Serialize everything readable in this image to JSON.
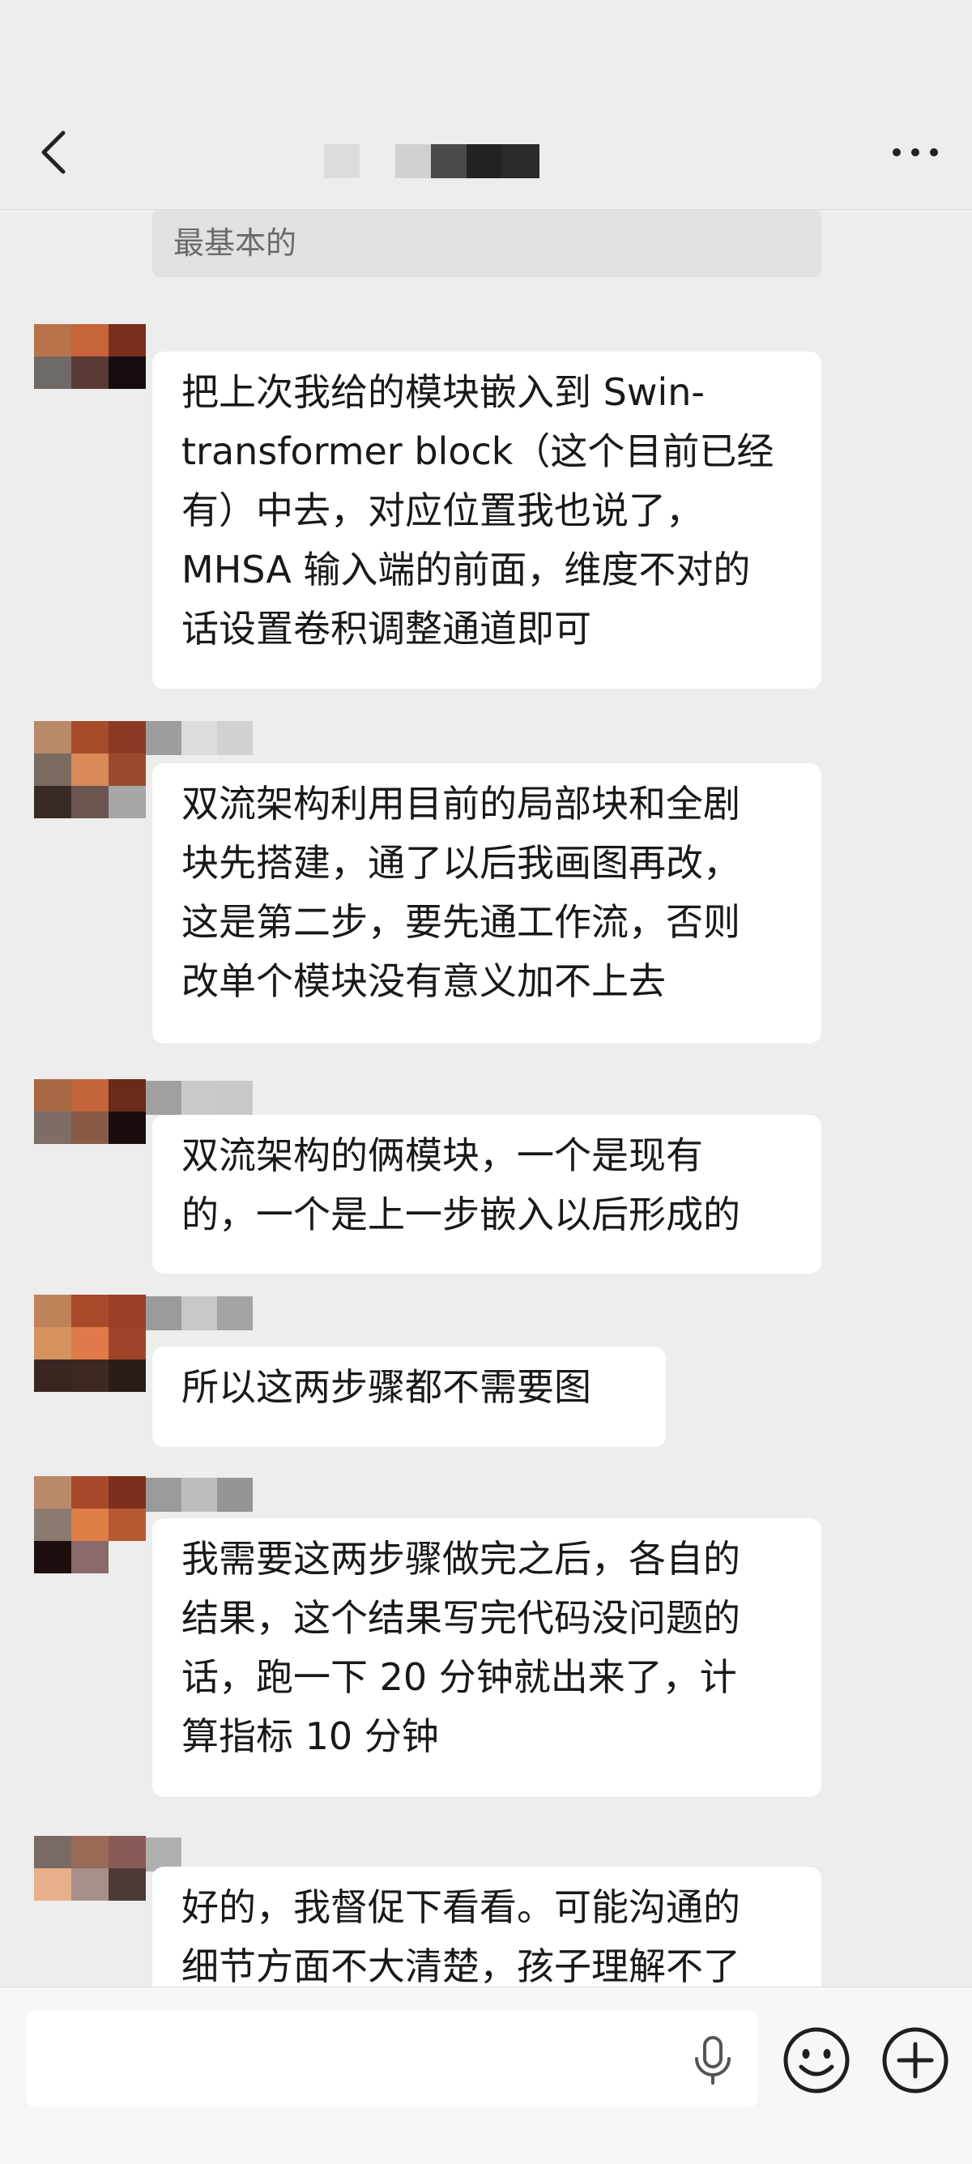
{
  "header": {
    "back_icon": "chevron-left-icon",
    "title": "■ ■■■■",
    "more_icon": "more-horizontal-icon"
  },
  "quoted_message": "最基本的",
  "messages": [
    {
      "text": "把上次我给的模块嵌入到 Swin-\ntransformer block（这个目前已经\n有）中去，对应位置我也说了，\nMHSA 输入端的前面，维度不对的\n话设置卷积调整通道即可"
    },
    {
      "text": "双流架构利用目前的局部块和全剧\n块先搭建，通了以后我画图再改，\n这是第二步，要先通工作流，否则\n改单个模块没有意义加不上去"
    },
    {
      "text": "双流架构的俩模块，一个是现有\n的，一个是上一步嵌入以后形成的"
    },
    {
      "text": "所以这两步骤都不需要图"
    },
    {
      "text": "我需要这两步骤做完之后，各自的\n结果，这个结果写完代码没问题的\n话，跑一下 20 分钟就出来了，计\n算指标 10 分钟"
    },
    {
      "text": "好的，我督促下看看。可能沟通的\n细节方面不大清楚，孩子理解不了"
    }
  ],
  "input_bar": {
    "placeholder": "",
    "mic_icon": "microphone-icon",
    "emoji_icon": "emoji-smile-icon",
    "plus_icon": "plus-circle-icon"
  },
  "colors": {
    "background": "#ededed",
    "bubble": "#ffffff",
    "quote_bg": "#e1e1e1",
    "text": "#191919"
  }
}
